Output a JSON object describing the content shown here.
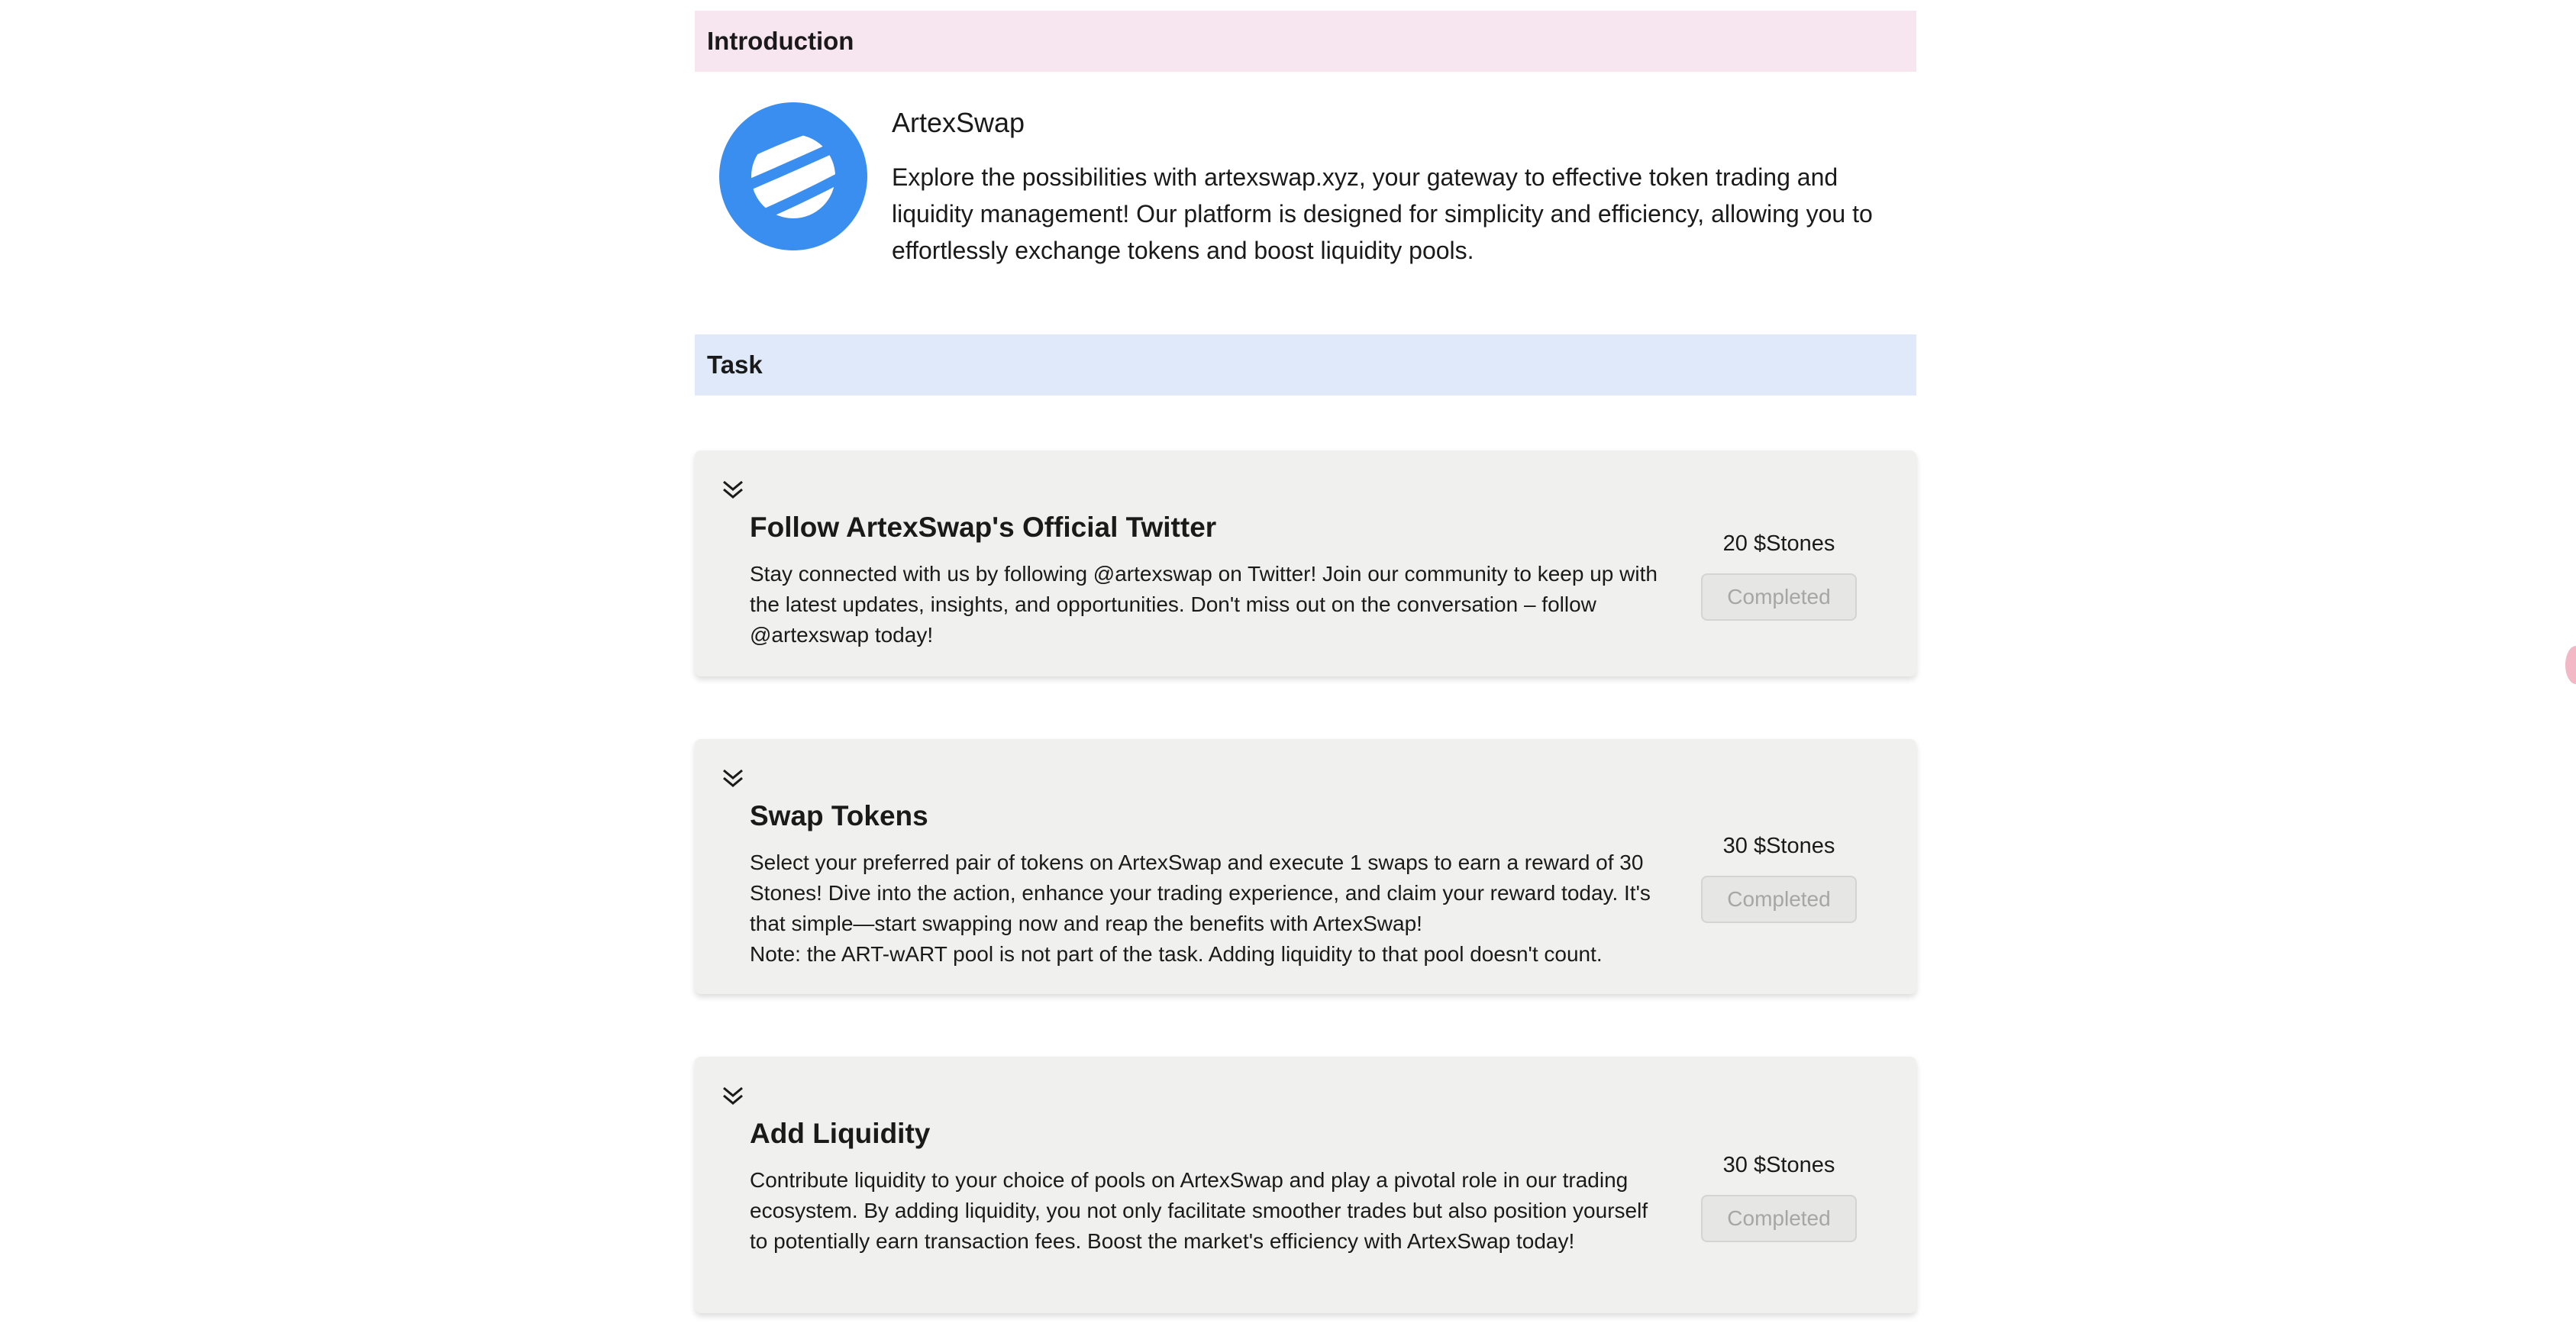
{
  "introduction": {
    "header": "Introduction",
    "title": "ArtexSwap",
    "description": "Explore the possibilities with artexswap.xyz, your gateway to effective token trading and liquidity management! Our platform is designed for simplicity and efficiency, allowing you to effortlessly exchange tokens and boost liquidity pools.",
    "logo_icon": "artexswap-logo-icon"
  },
  "task_section": {
    "header": "Task"
  },
  "tasks": [
    {
      "title": "Follow ArtexSwap's Official Twitter",
      "description": "Stay connected with us by following @artexswap on Twitter! Join our community to keep up with the latest updates, insights, and opportunities. Don't miss out on the conversation – follow @artexswap today!",
      "reward": "20 $Stones",
      "status": "Completed"
    },
    {
      "title": "Swap Tokens",
      "description": "Select your preferred pair of tokens on ArtexSwap and execute 1 swaps to earn a reward of 30 Stones! Dive into the action, enhance your trading experience, and claim your reward today. It's that simple—start swapping now and reap the benefits with ArtexSwap!\nNote: the ART-wART pool is not part of the task. Adding liquidity to that pool doesn't count.",
      "reward": "30 $Stones",
      "status": "Completed"
    },
    {
      "title": "Add Liquidity",
      "description": "Contribute liquidity to your choice of pools on ArtexSwap and play a pivotal role in our trading ecosystem. By adding liquidity, you not only facilitate smoother trades but also position yourself to potentially earn transaction fees. Boost the market's efficiency with ArtexSwap today!",
      "reward": "30 $Stones",
      "status": "Completed"
    }
  ],
  "colors": {
    "intro_header_bg": "#f7e5ef",
    "task_header_bg": "#dfe9f9",
    "card_bg": "#f0f0ee",
    "logo_blue": "#3a8ef0",
    "disabled_text": "#a6a6a4"
  }
}
